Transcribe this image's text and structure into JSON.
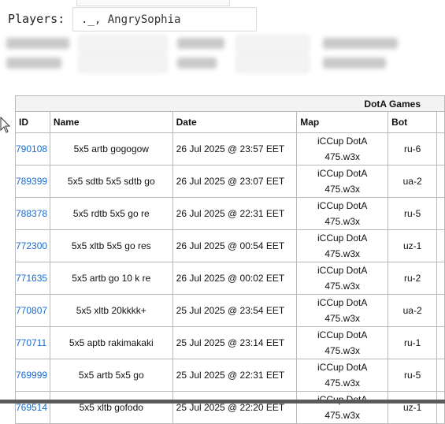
{
  "players": {
    "label": "Players:",
    "value": "._, AngrySophia"
  },
  "table": {
    "group_header": "DotA Games",
    "columns": [
      "ID",
      "Name",
      "Date",
      "Map",
      "Bot"
    ],
    "rows": [
      {
        "id": "790108",
        "name": "5x5 artb gogogow",
        "date": "26 Jul 2025 @ 23:57 EET",
        "map_line1": "iCCup DotA",
        "map_line2": "475.w3x",
        "bot": "ru-6"
      },
      {
        "id": "789399",
        "name": "5x5 sdtb 5x5 sdtb go",
        "date": "26 Jul 2025 @ 23:07 EET",
        "map_line1": "iCCup DotA",
        "map_line2": "475.w3x",
        "bot": "ua-2"
      },
      {
        "id": "788378",
        "name": "5x5 rdtb 5x5 go re",
        "date": "26 Jul 2025 @ 22:31 EET",
        "map_line1": "iCCup DotA",
        "map_line2": "475.w3x",
        "bot": "ru-5"
      },
      {
        "id": "772300",
        "name": "5x5 xltb 5x5 go res",
        "date": "26 Jul 2025 @ 00:54 EET",
        "map_line1": "iCCup DotA",
        "map_line2": "475.w3x",
        "bot": "uz-1"
      },
      {
        "id": "771635",
        "name": "5x5 artb go 10 k re",
        "date": "26 Jul 2025 @ 00:02 EET",
        "map_line1": "iCCup DotA",
        "map_line2": "475.w3x",
        "bot": "ru-2"
      },
      {
        "id": "770807",
        "name": "5x5 xltb 20kkkk+",
        "date": "25 Jul 2025 @ 23:54 EET",
        "map_line1": "iCCup DotA",
        "map_line2": "475.w3x",
        "bot": "ua-2"
      },
      {
        "id": "770711",
        "name": "5x5 aptb rakimakaki",
        "date": "25 Jul 2025 @ 23:14 EET",
        "map_line1": "iCCup DotA",
        "map_line2": "475.w3x",
        "bot": "ru-1"
      },
      {
        "id": "769999",
        "name": "5x5 artb 5x5 go",
        "date": "25 Jul 2025 @ 22:31 EET",
        "map_line1": "iCCup DotA",
        "map_line2": "475.w3x",
        "bot": "ru-5"
      },
      {
        "id": "769514",
        "name": "5x5 xltb gofodo",
        "date": "25 Jul 2025 @ 22:20 EET",
        "map_line1": "iCCup DotA",
        "map_line2": "475.w3x",
        "bot": "uz-1"
      }
    ]
  }
}
